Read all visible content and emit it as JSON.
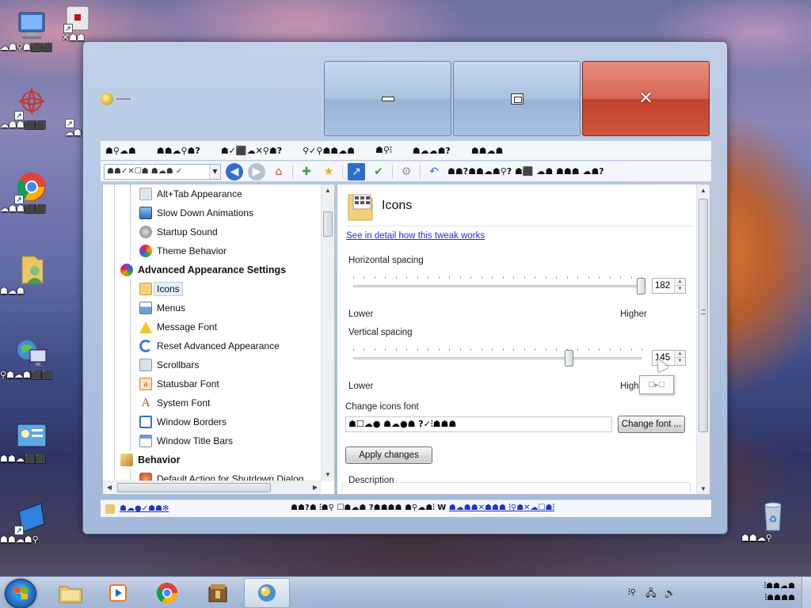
{
  "desktop": {
    "icons": [
      {
        "label": "☁☗⚲☗⬛⬛",
        "icon": "computer-icon",
        "shortcut": false
      },
      {
        "label": "✕☗☗",
        "icon": "app-icon",
        "shortcut": true
      },
      {
        "label": "☁☗☗⬛⬛",
        "icon": "flower-icon",
        "shortcut": true
      },
      {
        "label": "☁☗⚲",
        "icon": "folder-icon",
        "shortcut": true
      },
      {
        "label": "☁☗☗⬛⬛",
        "icon": "chrome-icon",
        "shortcut": true
      },
      {
        "label": "☗☁☗",
        "icon": "user-folder-icon",
        "shortcut": false
      },
      {
        "label": "⚲☗☁☗⬛⬛",
        "icon": "network-icon",
        "shortcut": false
      },
      {
        "label": "☗☗☁⬛⬛",
        "icon": "control-panel-icon",
        "shortcut": false
      },
      {
        "label": "☗☗☁☗⚲",
        "icon": "app-shortcut-icon",
        "shortcut": true
      },
      {
        "label": "☗☗☁⚲",
        "icon": "recycle-bin-icon",
        "shortcut": false
      }
    ],
    "wallpaper_accent": "#e0782a"
  },
  "window": {
    "title": "-----",
    "caption": {
      "minimize_label": "minimize",
      "maximize_label": "maximize",
      "close_label": "close"
    },
    "menu": [
      "☗⚲☁☗",
      "☗☗☁⚲☗?",
      "☗✓⬛☁✕⚲☗?",
      "⚲✓⚲☗☗☁☗",
      "☗⚲⫶",
      "☗☁☁☗?",
      "☗☗☁☗"
    ],
    "toolbar": {
      "combo_value": "☗☗✓✕☐☗ ☗☁☗ ✓",
      "combo_arrow": "▼",
      "back_glyph": "◀",
      "forward_glyph": "▶",
      "home_glyph": "⌂",
      "add_glyph": "✚",
      "star_glyph": "★",
      "shortcut_glyph": "↗",
      "check_glyph": "✔",
      "gear_glyph": "⚙",
      "undo_glyph": "↶",
      "undo_text": "☗☗?☗☗☁☗⚲? ☗⬛ ☁☗ ☗☗☗ ☁☗?"
    },
    "tree": {
      "items": [
        {
          "label": "Alt+Tab Appearance",
          "level": 2,
          "icon": "window-icon",
          "color": "#dde5ee"
        },
        {
          "label": "Slow Down Animations",
          "level": 2,
          "icon": "monitor-icon",
          "color": "#5a8fd0"
        },
        {
          "label": "Startup Sound",
          "level": 2,
          "icon": "speaker-icon",
          "color": "#8a8f97"
        },
        {
          "label": "Theme Behavior",
          "level": 2,
          "icon": "palette-icon",
          "color": "#9b3ec4"
        },
        {
          "label": "Advanced Appearance Settings",
          "level": 1,
          "icon": "paint-icon",
          "color": "#6a46c2",
          "group": true
        },
        {
          "label": "Icons",
          "level": 2,
          "icon": "icons-icon",
          "color": "#f3d27a",
          "selected": true
        },
        {
          "label": "Menus",
          "level": 2,
          "icon": "menus-icon",
          "color": "#6aa0dc"
        },
        {
          "label": "Message Font",
          "level": 2,
          "icon": "warning-icon",
          "color": "#f2c32b"
        },
        {
          "label": "Reset Advanced Appearance",
          "level": 2,
          "icon": "reset-icon",
          "color": "#3c7ed6"
        },
        {
          "label": "Scrollbars",
          "level": 2,
          "icon": "scrollbar-icon",
          "color": "#dbe1e8"
        },
        {
          "label": "Statusbar Font",
          "level": 2,
          "icon": "statusbar-font-icon",
          "color": "#e8b46a"
        },
        {
          "label": "System Font",
          "level": 2,
          "icon": "font-icon",
          "color": "#c0392b"
        },
        {
          "label": "Window Borders",
          "level": 2,
          "icon": "window-borders-icon",
          "color": "#3a72c4"
        },
        {
          "label": "Window Title Bars",
          "level": 2,
          "icon": "title-bar-icon",
          "color": "#dde5ee"
        },
        {
          "label": "Behavior",
          "level": 1,
          "icon": "behavior-icon",
          "color": "#e8c96a",
          "group": true
        },
        {
          "label": "Default Action for Shutdown Dialog",
          "level": 2,
          "icon": "shutdown-icon",
          "color": "#d35400"
        }
      ],
      "scroll_up": "▲",
      "scroll_down": "▼",
      "scroll_left": "◀",
      "scroll_right": "▶"
    },
    "content": {
      "title": "Icons",
      "detail_link": "See in detail how this tweak works",
      "horizontal": {
        "label": "Horizontal spacing",
        "value": "182",
        "fraction": 1.0,
        "low": "Lower",
        "high": "Higher"
      },
      "vertical": {
        "label": "Vertical spacing",
        "value": "145",
        "fraction": 0.75,
        "low": "Lower",
        "high": "Higher"
      },
      "font_label": "Change icons font",
      "font_value": "☗☐☁● ☗☁●☗ ?✓⫶☗☗☗",
      "change_font_button": "Change font ...",
      "apply_button": "Apply changes",
      "description_label": "Description",
      "spin_up": "▲",
      "spin_down": "▼",
      "tooltip_text": "☐▸☐"
    },
    "status": {
      "left_link": "☗☁●✓☗☗✻",
      "right_text": "☗☗?☗ ⫶☗⚲ ☐☗☁☗ ?☗☗☗☗ ☗⚲☁☗⫶ W",
      "right_link": "☗☁☗☗✕☗☗☗ ⫶⚲☗✕☁☐☗⫶"
    }
  },
  "taskbar": {
    "items": [
      {
        "name": "explorer",
        "icon": "folder-icon"
      },
      {
        "name": "media-player",
        "icon": "media-player-icon"
      },
      {
        "name": "chrome",
        "icon": "chrome-icon"
      },
      {
        "name": "archive",
        "icon": "archive-icon"
      },
      {
        "name": "tweaker",
        "icon": "tweaker-icon",
        "active": true
      }
    ],
    "tray": {
      "lang": "⫶⚲",
      "network_glyph": "🖧",
      "volume_glyph": "🔊",
      "clock_line1": "⫶☗☗☁☗",
      "clock_line2": "⫶☗☗☗☗"
    }
  }
}
